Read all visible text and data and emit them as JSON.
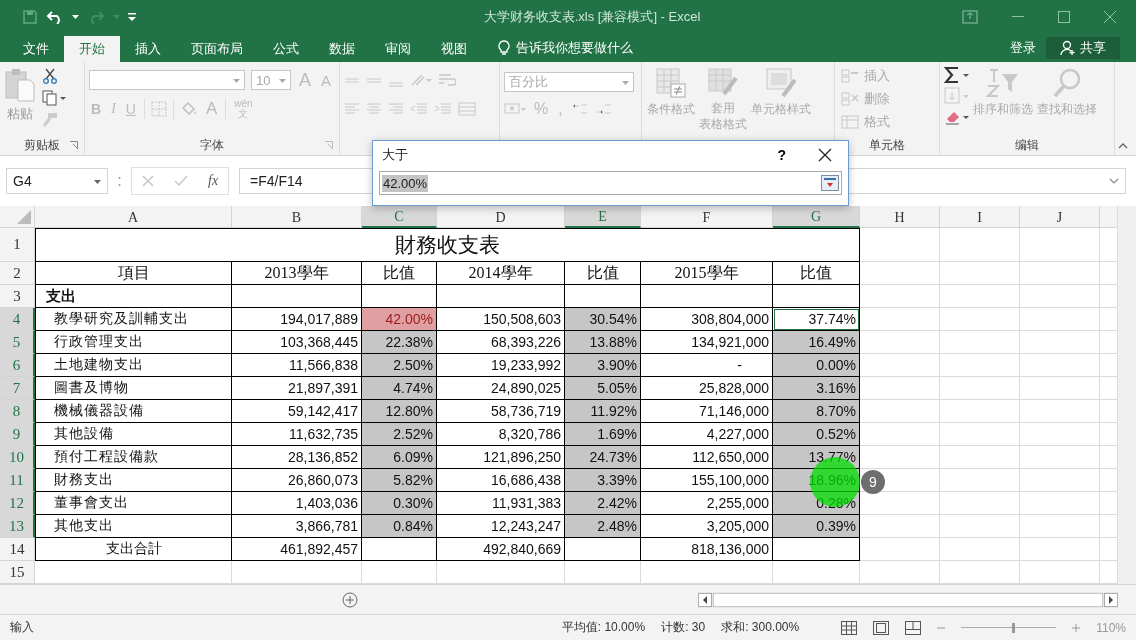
{
  "title_bar": {
    "title": "大学财务收支表.xls  [兼容模式] - Excel"
  },
  "menu_tabs": [
    {
      "label": "文件",
      "selected": false
    },
    {
      "label": "开始",
      "selected": true
    },
    {
      "label": "插入",
      "selected": false
    },
    {
      "label": "页面布局",
      "selected": false
    },
    {
      "label": "公式",
      "selected": false
    },
    {
      "label": "数据",
      "selected": false
    },
    {
      "label": "审阅",
      "selected": false
    },
    {
      "label": "视图",
      "selected": false
    }
  ],
  "tell_me": "告诉我你想要做什么",
  "sign_in": "登录",
  "share": "共享",
  "ribbon": {
    "clipboard": {
      "paste": "粘贴",
      "group": "剪贴板"
    },
    "font": {
      "size": "10",
      "grow": "A",
      "shrink": "A",
      "styles": [
        "B",
        "I",
        "U"
      ],
      "font_color": "A",
      "phonetic_top": "wén",
      "phonetic_bottom": "文",
      "group": "字体"
    },
    "number": {
      "format": "百分比",
      "percent": "%",
      "comma": ","
    },
    "styles": {
      "conditional": "条件格式",
      "table_top": "套用",
      "table_bottom": "表格格式",
      "cell_styles": "单元格样式"
    },
    "cells": {
      "insert": "插入",
      "delete": "删除",
      "format": "格式",
      "group": "单元格"
    },
    "editing": {
      "sort": "排序和筛选",
      "find": "查找和选择",
      "group": "编辑"
    }
  },
  "formula_bar": {
    "name_box": "G4",
    "function_label": "fx",
    "formula": "=F4/F14"
  },
  "dialog": {
    "title": "大于",
    "help": "?",
    "value": "42.00%"
  },
  "sheet": {
    "columns": [
      {
        "label": "A",
        "selected": false
      },
      {
        "label": "B",
        "selected": false
      },
      {
        "label": "C",
        "selected": true
      },
      {
        "label": "D",
        "selected": false
      },
      {
        "label": "E",
        "selected": true
      },
      {
        "label": "F",
        "selected": false
      },
      {
        "label": "G",
        "selected": true
      },
      {
        "label": "H",
        "selected": false
      },
      {
        "label": "I",
        "selected": false
      },
      {
        "label": "J",
        "selected": false
      }
    ],
    "rows": [
      {
        "number": "1",
        "selected": false,
        "title": "財務收支表"
      },
      {
        "number": "2",
        "selected": false,
        "cells": [
          {
            "text": "項目",
            "kind": "heading",
            "selected": false
          },
          {
            "text": "2013學年",
            "kind": "heading",
            "selected": false
          },
          {
            "text": "比值",
            "kind": "heading",
            "selected": false
          },
          {
            "text": "2014學年",
            "kind": "heading",
            "selected": false
          },
          {
            "text": "比值",
            "kind": "heading",
            "selected": false
          },
          {
            "text": "2015學年",
            "kind": "heading",
            "selected": false
          },
          {
            "text": "比值",
            "kind": "heading",
            "selected": false
          }
        ]
      },
      {
        "number": "3",
        "selected": false,
        "cells": [
          {
            "text": "支出",
            "kind": "section",
            "selected": false
          },
          {
            "selected": false
          },
          {
            "selected": false
          },
          {
            "selected": false
          },
          {
            "selected": false
          },
          {
            "selected": false
          },
          {
            "selected": false
          }
        ]
      },
      {
        "number": "4",
        "selected": true,
        "cells": [
          {
            "text": "教學研究及訓輔支出",
            "kind": "item",
            "selected": false
          },
          {
            "text": "194,017,889",
            "kind": "number",
            "selected": false
          },
          {
            "text": "42.00%",
            "kind": "number",
            "selected": true,
            "highlighted": true
          },
          {
            "text": "150,508,603",
            "kind": "number",
            "selected": false
          },
          {
            "text": "30.54%",
            "kind": "number",
            "selected": true
          },
          {
            "text": "308,804,000",
            "kind": "number",
            "selected": false
          },
          {
            "text": "37.74%",
            "kind": "number",
            "selected": true,
            "active": true
          }
        ]
      },
      {
        "number": "5",
        "selected": true,
        "cells": [
          {
            "text": "行政管理支出",
            "kind": "item",
            "selected": false
          },
          {
            "text": "103,368,445",
            "kind": "number",
            "selected": false
          },
          {
            "text": "22.38%",
            "kind": "number",
            "selected": true
          },
          {
            "text": "68,393,226",
            "kind": "number",
            "selected": false
          },
          {
            "text": "13.88%",
            "kind": "number",
            "selected": true
          },
          {
            "text": "134,921,000",
            "kind": "number",
            "selected": false
          },
          {
            "text": "16.49%",
            "kind": "number",
            "selected": true
          }
        ]
      },
      {
        "number": "6",
        "selected": true,
        "cells": [
          {
            "text": "土地建物支出",
            "kind": "item",
            "selected": false
          },
          {
            "text": "11,566,838",
            "kind": "number",
            "selected": false
          },
          {
            "text": "2.50%",
            "kind": "number",
            "selected": true
          },
          {
            "text": "19,233,992",
            "kind": "number",
            "selected": false
          },
          {
            "text": "3.90%",
            "kind": "number",
            "selected": true
          },
          {
            "text": "-",
            "kind": "dash",
            "selected": false
          },
          {
            "text": "0.00%",
            "kind": "number",
            "selected": true
          }
        ]
      },
      {
        "number": "7",
        "selected": true,
        "cells": [
          {
            "text": "圖書及博物",
            "kind": "item",
            "selected": false
          },
          {
            "text": "21,897,391",
            "kind": "number",
            "selected": false
          },
          {
            "text": "4.74%",
            "kind": "number",
            "selected": true
          },
          {
            "text": "24,890,025",
            "kind": "number",
            "selected": false
          },
          {
            "text": "5.05%",
            "kind": "number",
            "selected": true
          },
          {
            "text": "25,828,000",
            "kind": "number",
            "selected": false
          },
          {
            "text": "3.16%",
            "kind": "number",
            "selected": true
          }
        ]
      },
      {
        "number": "8",
        "selected": true,
        "cells": [
          {
            "text": "機械儀器設備",
            "kind": "item",
            "selected": false
          },
          {
            "text": "59,142,417",
            "kind": "number",
            "selected": false
          },
          {
            "text": "12.80%",
            "kind": "number",
            "selected": true
          },
          {
            "text": "58,736,719",
            "kind": "number",
            "selected": false
          },
          {
            "text": "11.92%",
            "kind": "number",
            "selected": true
          },
          {
            "text": "71,146,000",
            "kind": "number",
            "selected": false
          },
          {
            "text": "8.70%",
            "kind": "number",
            "selected": true
          }
        ]
      },
      {
        "number": "9",
        "selected": true,
        "cells": [
          {
            "text": "其他設備",
            "kind": "item",
            "selected": false
          },
          {
            "text": "11,632,735",
            "kind": "number",
            "selected": false
          },
          {
            "text": "2.52%",
            "kind": "number",
            "selected": true
          },
          {
            "text": "8,320,786",
            "kind": "number",
            "selected": false
          },
          {
            "text": "1.69%",
            "kind": "number",
            "selected": true
          },
          {
            "text": "4,227,000",
            "kind": "number",
            "selected": false
          },
          {
            "text": "0.52%",
            "kind": "number",
            "selected": true
          }
        ]
      },
      {
        "number": "10",
        "selected": true,
        "cells": [
          {
            "text": "預付工程設備款",
            "kind": "item",
            "selected": false
          },
          {
            "text": "28,136,852",
            "kind": "number",
            "selected": false
          },
          {
            "text": "6.09%",
            "kind": "number",
            "selected": true
          },
          {
            "text": "121,896,250",
            "kind": "number",
            "selected": false
          },
          {
            "text": "24.73%",
            "kind": "number",
            "selected": true
          },
          {
            "text": "112,650,000",
            "kind": "number",
            "selected": false
          },
          {
            "text": "13.77%",
            "kind": "number",
            "selected": true
          }
        ]
      },
      {
        "number": "11",
        "selected": true,
        "cells": [
          {
            "text": "財務支出",
            "kind": "item",
            "selected": false
          },
          {
            "text": "26,860,073",
            "kind": "number",
            "selected": false
          },
          {
            "text": "5.82%",
            "kind": "number",
            "selected": true
          },
          {
            "text": "16,686,438",
            "kind": "number",
            "selected": false
          },
          {
            "text": "3.39%",
            "kind": "number",
            "selected": true
          },
          {
            "text": "155,100,000",
            "kind": "number",
            "selected": false
          },
          {
            "text": "18.96%",
            "kind": "number",
            "selected": true
          }
        ]
      },
      {
        "number": "12",
        "selected": true,
        "cells": [
          {
            "text": "董事會支出",
            "kind": "item",
            "selected": false
          },
          {
            "text": "1,403,036",
            "kind": "number",
            "selected": false
          },
          {
            "text": "0.30%",
            "kind": "number",
            "selected": true
          },
          {
            "text": "11,931,383",
            "kind": "number",
            "selected": false
          },
          {
            "text": "2.42%",
            "kind": "number",
            "selected": true
          },
          {
            "text": "2,255,000",
            "kind": "number",
            "selected": false
          },
          {
            "text": "0.28%",
            "kind": "number",
            "selected": true
          }
        ]
      },
      {
        "number": "13",
        "selected": true,
        "cells": [
          {
            "text": "其他支出",
            "kind": "item",
            "selected": false
          },
          {
            "text": "3,866,781",
            "kind": "number",
            "selected": false
          },
          {
            "text": "0.84%",
            "kind": "number",
            "selected": true
          },
          {
            "text": "12,243,247",
            "kind": "number",
            "selected": false
          },
          {
            "text": "2.48%",
            "kind": "number",
            "selected": true
          },
          {
            "text": "3,205,000",
            "kind": "number",
            "selected": false
          },
          {
            "text": "0.39%",
            "kind": "number",
            "selected": true
          }
        ]
      },
      {
        "number": "14",
        "selected": false,
        "cells": [
          {
            "text": "支出合計",
            "kind": "total",
            "selected": false
          },
          {
            "text": "461,892,457",
            "kind": "number",
            "selected": false
          },
          {
            "selected": false
          },
          {
            "text": "492,840,669",
            "kind": "number",
            "selected": false
          },
          {
            "selected": false
          },
          {
            "text": "818,136,000",
            "kind": "number",
            "selected": false
          },
          {
            "selected": false
          }
        ]
      },
      {
        "number": "15",
        "selected": false,
        "cells": []
      }
    ]
  },
  "status_bar": {
    "mode": "输入",
    "average": "平均值: 10.00%",
    "count": "计数: 30",
    "sum": "求和: 300.00%",
    "zoom": "110%",
    "zoom_slider": {
      "level": 0.55
    }
  },
  "step_marker": {
    "number": "9"
  }
}
